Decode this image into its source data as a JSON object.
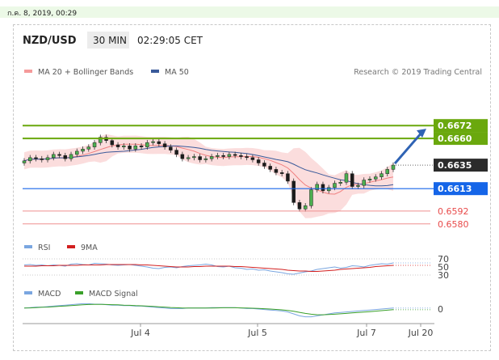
{
  "timestamp": "ก.ค. 8, 2019, 00:29",
  "header": {
    "pair": "NZD/USD",
    "timeframe": "30 MIN",
    "time": "02:29:05 CET"
  },
  "legend": {
    "ma20": "MA 20 + Bollinger Bands",
    "ma50": "MA 50",
    "credit": "Research © 2019 Trading Central"
  },
  "colors": {
    "resistance": "#6aa80d",
    "support": "#1565e8",
    "current": "#2b2b2b",
    "level_red": "#e84a4a",
    "bands": "#f8c7c7",
    "ma50": "#3a5a9a",
    "arrow": "#2f63b4"
  },
  "chart_data": [
    {
      "type": "line",
      "title": "",
      "x_ticks": [
        "Jul 4",
        "Jul 5",
        "Jul 7",
        "Jul 20"
      ],
      "ylim": [
        0.657,
        0.671
      ],
      "series": [
        {
          "name": "",
          "values": [
            0.6639,
            0.6642,
            0.6641,
            0.664,
            0.6642,
            0.6645,
            0.6644,
            0.6641,
            0.6645,
            0.6648,
            0.665,
            0.6652,
            0.6656,
            0.6661,
            0.6658,
            0.6654,
            0.6652,
            0.6653,
            0.665,
            0.6653,
            0.6652,
            0.6656,
            0.6657,
            0.6655,
            0.6652,
            0.6649,
            0.6645,
            0.6641,
            0.6642,
            0.6643,
            0.664,
            0.6641,
            0.6643,
            0.6644,
            0.6643,
            0.6645,
            0.6644,
            0.6643,
            0.6642,
            0.664,
            0.6637,
            0.6634,
            0.6631,
            0.6628,
            0.6627,
            0.662,
            0.66,
            0.6594,
            0.6597,
            0.6612,
            0.6617,
            0.6611,
            0.6614,
            0.6618,
            0.6619,
            0.6627,
            0.6615,
            0.6616,
            0.6621,
            0.6622,
            0.6624,
            0.6627,
            0.6631,
            0.6635
          ]
        }
      ],
      "levels": [
        {
          "value": 0.6672,
          "label": "0.6672",
          "kind": "resistance"
        },
        {
          "value": 0.666,
          "label": "0.6660",
          "kind": "resistance"
        },
        {
          "value": 0.6635,
          "label": "0.6635",
          "kind": "current"
        },
        {
          "value": 0.6613,
          "label": "0.6613",
          "kind": "support"
        },
        {
          "value": 0.6592,
          "label": "0.6592",
          "kind": "red"
        },
        {
          "value": 0.658,
          "label": "0.6580",
          "kind": "red"
        }
      ]
    },
    {
      "type": "line",
      "legend": [
        "RSI",
        "9MA"
      ],
      "y_ticks": [
        "70",
        "50",
        "30"
      ],
      "ylim": [
        20,
        80
      ],
      "series": [
        {
          "name": "RSI",
          "values": [
            55,
            56,
            54,
            55,
            53,
            55,
            54,
            52,
            57,
            58,
            56,
            55,
            59,
            58,
            57,
            55,
            54,
            55,
            56,
            54,
            52,
            50,
            47,
            46,
            49,
            50,
            48,
            51,
            53,
            54,
            55,
            57,
            55,
            51,
            50,
            52,
            48,
            47,
            44,
            45,
            42,
            43,
            40,
            38,
            36,
            33,
            32,
            35,
            38,
            40,
            44,
            46,
            48,
            50,
            47,
            49,
            53,
            52,
            50,
            54,
            56,
            58,
            57,
            60
          ]
        },
        {
          "name": "9MA",
          "values": [
            52,
            52,
            52,
            53,
            53,
            53,
            54,
            54,
            54,
            54,
            55,
            55,
            55,
            55,
            56,
            56,
            56,
            56,
            56,
            56,
            55,
            55,
            54,
            53,
            52,
            51,
            50,
            50,
            50,
            51,
            51,
            52,
            52,
            52,
            52,
            52,
            51,
            51,
            50,
            49,
            48,
            47,
            46,
            45,
            44,
            42,
            41,
            40,
            40,
            39,
            39,
            40,
            41,
            42,
            44,
            45,
            46,
            47,
            48,
            49,
            51,
            52,
            53,
            54
          ]
        }
      ]
    },
    {
      "type": "line",
      "legend": [
        "MACD",
        "MACD Signal"
      ],
      "y_ticks": [
        "0"
      ],
      "ylim": [
        -10,
        10
      ],
      "series": [
        {
          "name": "MACD",
          "values": [
            1,
            1.5,
            2,
            2,
            2.5,
            3,
            3.5,
            4,
            4.5,
            5,
            5.5,
            5.5,
            5,
            5,
            4.5,
            4,
            4,
            3.5,
            3.5,
            3,
            3,
            2.5,
            2,
            1.5,
            1,
            0.5,
            0.5,
            0.5,
            1,
            1,
            1,
            1,
            1.5,
            1.5,
            1.5,
            1.5,
            1.5,
            1,
            0.5,
            0.5,
            0,
            -0.5,
            -1,
            -1.5,
            -2,
            -3,
            -5,
            -7,
            -8,
            -8,
            -7,
            -6,
            -5,
            -4,
            -3.5,
            -3,
            -2.5,
            -2,
            -1.5,
            -1,
            -0.5,
            0,
            0.5,
            1
          ]
        },
        {
          "name": "MACD Signal",
          "values": [
            1,
            1.2,
            1.5,
            1.8,
            2,
            2.4,
            2.8,
            3.2,
            3.6,
            4,
            4.4,
            4.7,
            4.8,
            4.8,
            4.7,
            4.5,
            4.3,
            4,
            3.8,
            3.5,
            3.3,
            3,
            2.7,
            2.3,
            2,
            1.6,
            1.3,
            1.1,
            1,
            1,
            1,
            1,
            1.1,
            1.2,
            1.3,
            1.3,
            1.3,
            1.2,
            1,
            0.8,
            0.6,
            0.3,
            0,
            -0.4,
            -0.8,
            -1.4,
            -2.3,
            -3.4,
            -4.5,
            -5.3,
            -5.8,
            -5.9,
            -5.7,
            -5.3,
            -4.9,
            -4.5,
            -4,
            -3.6,
            -3.1,
            -2.7,
            -2.2,
            -1.7,
            -1.2,
            -0.7
          ]
        }
      ]
    }
  ]
}
